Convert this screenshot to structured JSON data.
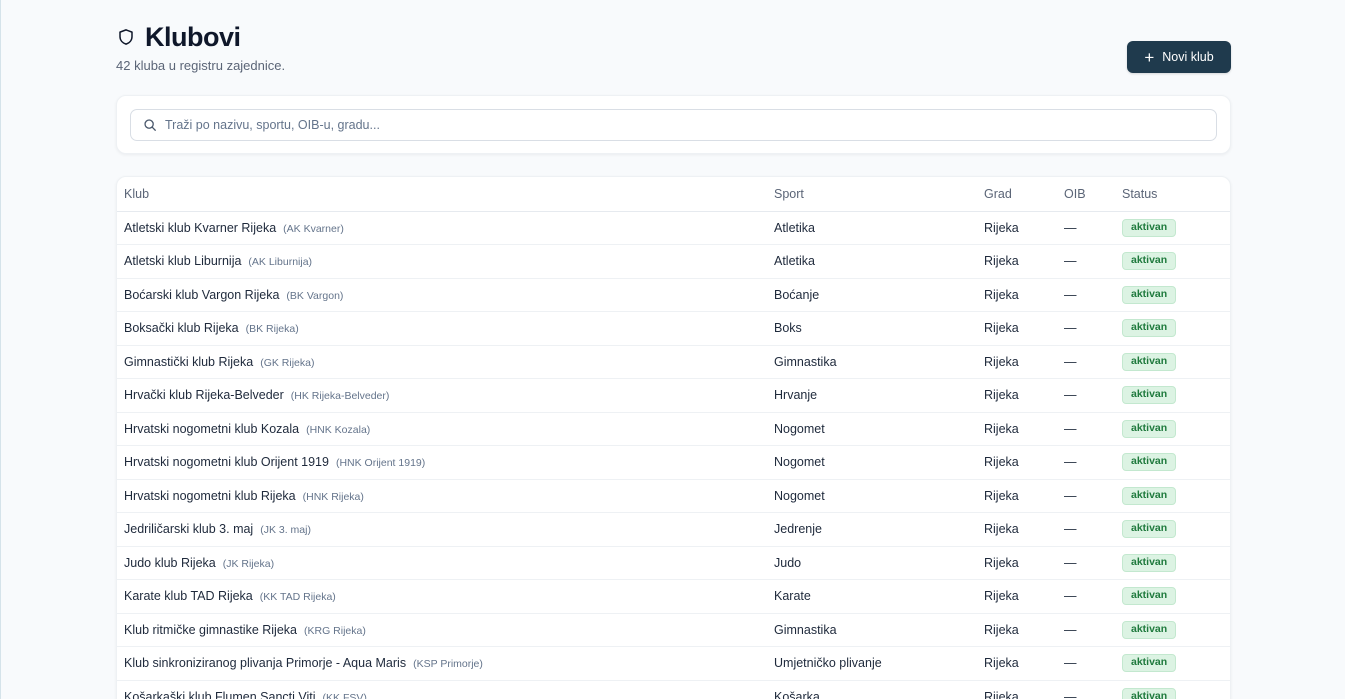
{
  "header": {
    "title": "Klubovi",
    "subtitle": "42 kluba u registru zajednice.",
    "new_button_label": "Novi klub"
  },
  "search": {
    "placeholder": "Traži po nazivu, sportu, OIB-u, gradu...",
    "value": ""
  },
  "table": {
    "columns": [
      "Klub",
      "Sport",
      "Grad",
      "OIB",
      "Status"
    ],
    "rows": [
      {
        "name": "Atletski klub Kvarner Rijeka",
        "short": "(AK Kvarner)",
        "sport": "Atletika",
        "city": "Rijeka",
        "oib": "—",
        "status": "aktivan"
      },
      {
        "name": "Atletski klub Liburnija",
        "short": "(AK Liburnija)",
        "sport": "Atletika",
        "city": "Rijeka",
        "oib": "—",
        "status": "aktivan"
      },
      {
        "name": "Boćarski klub Vargon Rijeka",
        "short": "(BK Vargon)",
        "sport": "Boćanje",
        "city": "Rijeka",
        "oib": "—",
        "status": "aktivan"
      },
      {
        "name": "Boksački klub Rijeka",
        "short": "(BK Rijeka)",
        "sport": "Boks",
        "city": "Rijeka",
        "oib": "—",
        "status": "aktivan"
      },
      {
        "name": "Gimnastički klub Rijeka",
        "short": "(GK Rijeka)",
        "sport": "Gimnastika",
        "city": "Rijeka",
        "oib": "—",
        "status": "aktivan"
      },
      {
        "name": "Hrvački klub Rijeka-Belveder",
        "short": "(HK Rijeka-Belveder)",
        "sport": "Hrvanje",
        "city": "Rijeka",
        "oib": "—",
        "status": "aktivan"
      },
      {
        "name": "Hrvatski nogometni klub Kozala",
        "short": "(HNK Kozala)",
        "sport": "Nogomet",
        "city": "Rijeka",
        "oib": "—",
        "status": "aktivan"
      },
      {
        "name": "Hrvatski nogometni klub Orijent 1919",
        "short": "(HNK Orijent 1919)",
        "sport": "Nogomet",
        "city": "Rijeka",
        "oib": "—",
        "status": "aktivan"
      },
      {
        "name": "Hrvatski nogometni klub Rijeka",
        "short": "(HNK Rijeka)",
        "sport": "Nogomet",
        "city": "Rijeka",
        "oib": "—",
        "status": "aktivan"
      },
      {
        "name": "Jedriličarski klub 3. maj",
        "short": "(JK 3. maj)",
        "sport": "Jedrenje",
        "city": "Rijeka",
        "oib": "—",
        "status": "aktivan"
      },
      {
        "name": "Judo klub Rijeka",
        "short": "(JK Rijeka)",
        "sport": "Judo",
        "city": "Rijeka",
        "oib": "—",
        "status": "aktivan"
      },
      {
        "name": "Karate klub TAD Rijeka",
        "short": "(KK TAD Rijeka)",
        "sport": "Karate",
        "city": "Rijeka",
        "oib": "—",
        "status": "aktivan"
      },
      {
        "name": "Klub ritmičke gimnastike Rijeka",
        "short": "(KRG Rijeka)",
        "sport": "Gimnastika",
        "city": "Rijeka",
        "oib": "—",
        "status": "aktivan"
      },
      {
        "name": "Klub sinkroniziranog plivanja Primorje - Aqua Maris",
        "short": "(KSP Primorje)",
        "sport": "Umjetničko plivanje",
        "city": "Rijeka",
        "oib": "—",
        "status": "aktivan"
      },
      {
        "name": "Košarkaški klub Flumen Sancti Viti",
        "short": "(KK FSV)",
        "sport": "Košarka",
        "city": "Rijeka",
        "oib": "—",
        "status": "aktivan"
      }
    ]
  },
  "colors": {
    "primary_button": "#1f3a4d",
    "badge_bg": "#dcf3e3",
    "badge_text": "#1f7a3d"
  },
  "icons": {
    "title": "shield-icon",
    "new_button": "plus-icon",
    "search": "search-icon"
  }
}
